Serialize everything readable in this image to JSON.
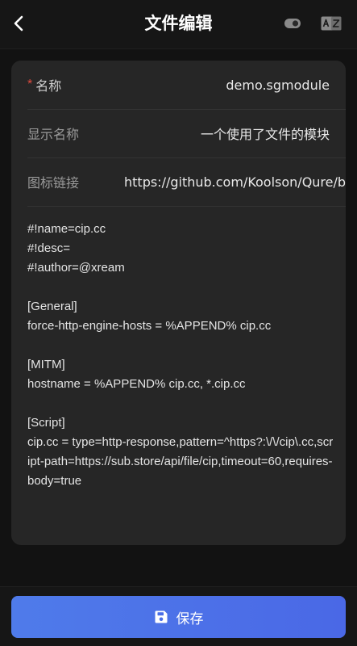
{
  "header": {
    "title": "文件编辑",
    "back_icon": "chevron-left-icon",
    "toggle_icon": "toggle-icon",
    "translate_icon": "translate-icon"
  },
  "form": {
    "name": {
      "required_mark": "*",
      "label": "名称",
      "value": "demo.sgmodule"
    },
    "display_name": {
      "label": "显示名称",
      "value": "一个使用了文件的模块"
    },
    "icon_link": {
      "label": "图标链接",
      "value": "https://github.com/Koolson/Qure/b"
    },
    "content": "#!name=cip.cc\n#!desc=\n#!author=@xream\n\n[General]\nforce-http-engine-hosts = %APPEND% cip.cc\n\n[MITM]\nhostname = %APPEND% cip.cc, *.cip.cc\n\n[Script]\ncip.cc = type=http-response,pattern=^https?:\\/\\/cip\\.cc,script-path=https://sub.store/api/file/cip,timeout=60,requires-body=true"
  },
  "footer": {
    "save_label": "保存",
    "save_icon": "save-icon"
  },
  "colors": {
    "background": "#121212",
    "card": "#262626",
    "accent": "#4a6ee7",
    "required": "#e04b3f"
  }
}
